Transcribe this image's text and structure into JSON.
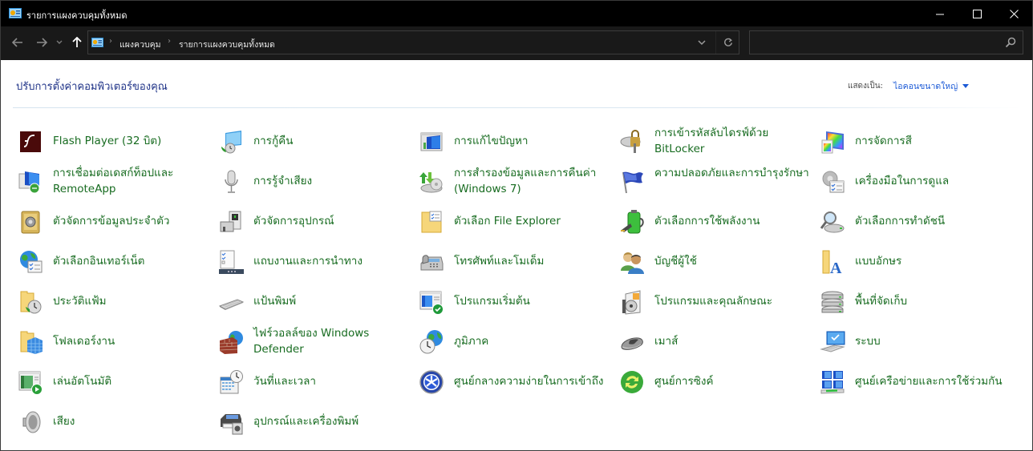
{
  "window": {
    "title": "รายการแผงควบคุมทั้งหมด",
    "controls": {
      "minimize": "minimize",
      "maximize": "maximize",
      "close": "close"
    }
  },
  "nav": {
    "breadcrumb": [
      "แผงควบคุม",
      "รายการแผงควบคุมทั้งหมด"
    ],
    "search_placeholder": "",
    "search_value": ""
  },
  "content": {
    "heading": "ปรับการตั้งค่าคอมพิวเตอร์ของคุณ",
    "view_by_label": "แสดงเป็น:",
    "view_by_value": "ไอคอนขนาดใหญ่"
  },
  "items": [
    {
      "label": "Flash Player (32 บิต)",
      "icon": "flash-player-icon"
    },
    {
      "label": "การกู้คืน",
      "icon": "recovery-icon"
    },
    {
      "label": "การแก้ไขปัญหา",
      "icon": "troubleshooting-icon"
    },
    {
      "label": "การเข้ารหัสลับไดรฟ์ด้วย BitLocker",
      "icon": "bitlocker-icon"
    },
    {
      "label": "การจัดการสี",
      "icon": "color-management-icon"
    },
    {
      "label": "การเชื่อมต่อเดสก์ท็อปและ RemoteApp",
      "icon": "remoteapp-icon"
    },
    {
      "label": "การรู้จำเสียง",
      "icon": "speech-recognition-icon"
    },
    {
      "label": "การสำรองข้อมูลและการคืนค่า (Windows 7)",
      "icon": "backup-restore-icon"
    },
    {
      "label": "ความปลอดภัยและการบำรุงรักษา",
      "icon": "security-maintenance-icon"
    },
    {
      "label": "เครื่องมือในการดูแล",
      "icon": "administrative-tools-icon"
    },
    {
      "label": "ตัวจัดการข้อมูลประจำตัว",
      "icon": "credential-manager-icon"
    },
    {
      "label": "ตัวจัดการอุปกรณ์",
      "icon": "device-manager-icon"
    },
    {
      "label": "ตัวเลือก File Explorer",
      "icon": "file-explorer-options-icon"
    },
    {
      "label": "ตัวเลือกการใช้พลังงาน",
      "icon": "power-options-icon"
    },
    {
      "label": "ตัวเลือกการทำดัชนี",
      "icon": "indexing-options-icon"
    },
    {
      "label": "ตัวเลือกอินเทอร์เน็ต",
      "icon": "internet-options-icon"
    },
    {
      "label": "แถบงานและการนำทาง",
      "icon": "taskbar-navigation-icon"
    },
    {
      "label": "โทรศัพท์และโมเด็ม",
      "icon": "phone-modem-icon"
    },
    {
      "label": "บัญชีผู้ใช้",
      "icon": "user-accounts-icon"
    },
    {
      "label": "แบบอักษร",
      "icon": "fonts-icon"
    },
    {
      "label": "ประวัติแฟ้ม",
      "icon": "file-history-icon"
    },
    {
      "label": "แป้นพิมพ์",
      "icon": "keyboard-icon"
    },
    {
      "label": "โปรแกรมเริ่มต้น",
      "icon": "default-programs-icon"
    },
    {
      "label": "โปรแกรมและคุณลักษณะ",
      "icon": "programs-features-icon"
    },
    {
      "label": "พื้นที่จัดเก็บ",
      "icon": "storage-spaces-icon"
    },
    {
      "label": "โฟลเดอร์งาน",
      "icon": "work-folders-icon"
    },
    {
      "label": "ไฟร์วอลล์ของ Windows Defender",
      "icon": "firewall-icon"
    },
    {
      "label": "ภูมิภาค",
      "icon": "region-icon"
    },
    {
      "label": "เมาส์",
      "icon": "mouse-icon"
    },
    {
      "label": "ระบบ",
      "icon": "system-icon"
    },
    {
      "label": "เล่นอัตโนมัติ",
      "icon": "autoplay-icon"
    },
    {
      "label": "วันที่และเวลา",
      "icon": "date-time-icon"
    },
    {
      "label": "ศูนย์กลางความง่ายในการเข้าถึง",
      "icon": "ease-of-access-icon"
    },
    {
      "label": "ศูนย์การซิงค์",
      "icon": "sync-center-icon"
    },
    {
      "label": "ศูนย์เครือข่ายและการใช้ร่วมกัน",
      "icon": "network-sharing-icon"
    },
    {
      "label": "เสียง",
      "icon": "sound-icon"
    },
    {
      "label": "อุปกรณ์และเครื่องพิมพ์",
      "icon": "devices-printers-icon"
    }
  ],
  "colors": {
    "titlebar_bg": "#000000",
    "navbar_bg": "#191919",
    "link_green": "#186c21",
    "heading_blue": "#1e3287",
    "accent_blue": "#1c5ad6"
  }
}
